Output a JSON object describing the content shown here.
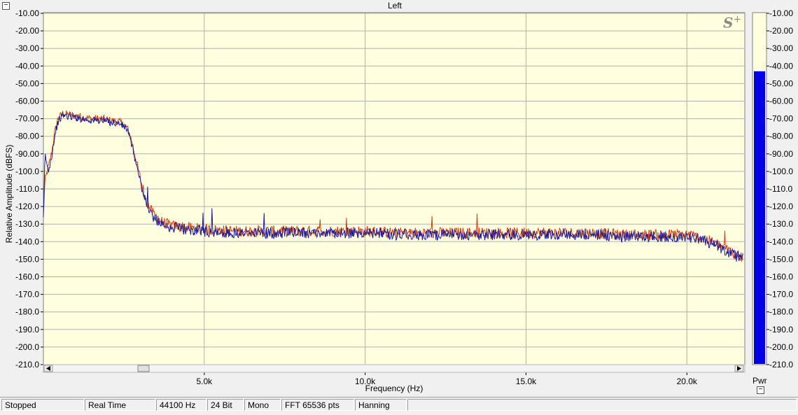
{
  "window": {
    "title": "Left",
    "minimize_glyph": "−"
  },
  "chart_data": {
    "type": "line",
    "title": "Left",
    "xlabel": "Frequency (Hz)",
    "ylabel": "Relative Amplitude (dBFS)",
    "xlim": [
      0,
      21800
    ],
    "ylim": [
      -210,
      -10
    ],
    "x_ticks": [
      {
        "value": 5000,
        "label": "5.0k"
      },
      {
        "value": 10000,
        "label": "10.0k"
      },
      {
        "value": 15000,
        "label": "15.0k"
      },
      {
        "value": 20000,
        "label": "20.0k"
      }
    ],
    "y_ticks": [
      "-10.00",
      "-20.00",
      "-30.00",
      "-40.00",
      "-50.00",
      "-60.00",
      "-70.00",
      "-80.00",
      "-90.00",
      "-100.0",
      "-110.0",
      "-120.0",
      "-130.0",
      "-140.0",
      "-150.0",
      "-160.0",
      "-170.0",
      "-180.0",
      "-190.0",
      "-200.0",
      "-210.0"
    ],
    "grid": true,
    "series": [
      {
        "color": "#d04010",
        "x": [
          0,
          50,
          150,
          250,
          350,
          450,
          600,
          900,
          1200,
          1500,
          1800,
          2100,
          2400,
          2600,
          2750,
          2900,
          3050,
          3200,
          3400,
          3700,
          4000,
          4500,
          5000,
          6000,
          7000,
          8000,
          9000,
          10000,
          11000,
          12000,
          13000,
          14000,
          15000,
          16000,
          17000,
          18000,
          19000,
          20000,
          20500,
          21000,
          21400,
          21750
        ],
        "y": [
          -125,
          -105,
          -98,
          -90,
          -78,
          -70,
          -67,
          -68,
          -69,
          -70,
          -70,
          -71,
          -72,
          -75,
          -83,
          -95,
          -107,
          -117,
          -124,
          -129,
          -131,
          -132,
          -133,
          -134,
          -134,
          -134,
          -134,
          -134,
          -135,
          -135,
          -135,
          -135,
          -135,
          -135,
          -135,
          -136,
          -136,
          -136,
          -138,
          -142,
          -146,
          -149
        ]
      },
      {
        "color": "#1a1aa0",
        "x": [
          0,
          50,
          150,
          250,
          350,
          450,
          600,
          900,
          1200,
          1500,
          1800,
          2100,
          2400,
          2600,
          2750,
          2900,
          3050,
          3200,
          3400,
          3700,
          4000,
          4500,
          5000,
          6000,
          7000,
          8000,
          9000,
          10000,
          11000,
          12000,
          13000,
          14000,
          15000,
          16000,
          17000,
          18000,
          19000,
          20000,
          20500,
          21000,
          21400,
          21750
        ],
        "y": [
          -128,
          -90,
          -100,
          -92,
          -80,
          -72,
          -68,
          -69,
          -70,
          -71,
          -71,
          -72,
          -73,
          -76,
          -85,
          -97,
          -109,
          -119,
          -126,
          -130,
          -132,
          -133,
          -134,
          -135,
          -135,
          -135,
          -135,
          -135,
          -136,
          -136,
          -136,
          -136,
          -136,
          -136,
          -136,
          -137,
          -137,
          -137,
          -139,
          -143,
          -147,
          -150
        ]
      }
    ]
  },
  "meter": {
    "label": "Pwr",
    "ylim": [
      -210,
      -10
    ],
    "value": -43,
    "bar_color": "#0000e8",
    "y_ticks": [
      "-10.00",
      "-20.00",
      "-30.00",
      "-40.00",
      "-50.00",
      "-60.00",
      "-70.00",
      "-80.00",
      "-90.00",
      "-100.0",
      "-110.0",
      "-120.0",
      "-130.0",
      "-140.0",
      "-150.0",
      "-160.0",
      "-170.0",
      "-180.0",
      "-190.0",
      "-200.0",
      "-210.0"
    ]
  },
  "status": {
    "state": "Stopped",
    "mode": "Real Time",
    "sample_rate": "44100 Hz",
    "bit_depth": "24 Bit",
    "channels": "Mono",
    "fft_size": "FFT 65536 pts",
    "window": "Hanning"
  },
  "colors": {
    "plot_bg": "#ffffe0",
    "grid": "#b0b0b0"
  },
  "logo": {
    "text": "S",
    "sup": "+"
  }
}
